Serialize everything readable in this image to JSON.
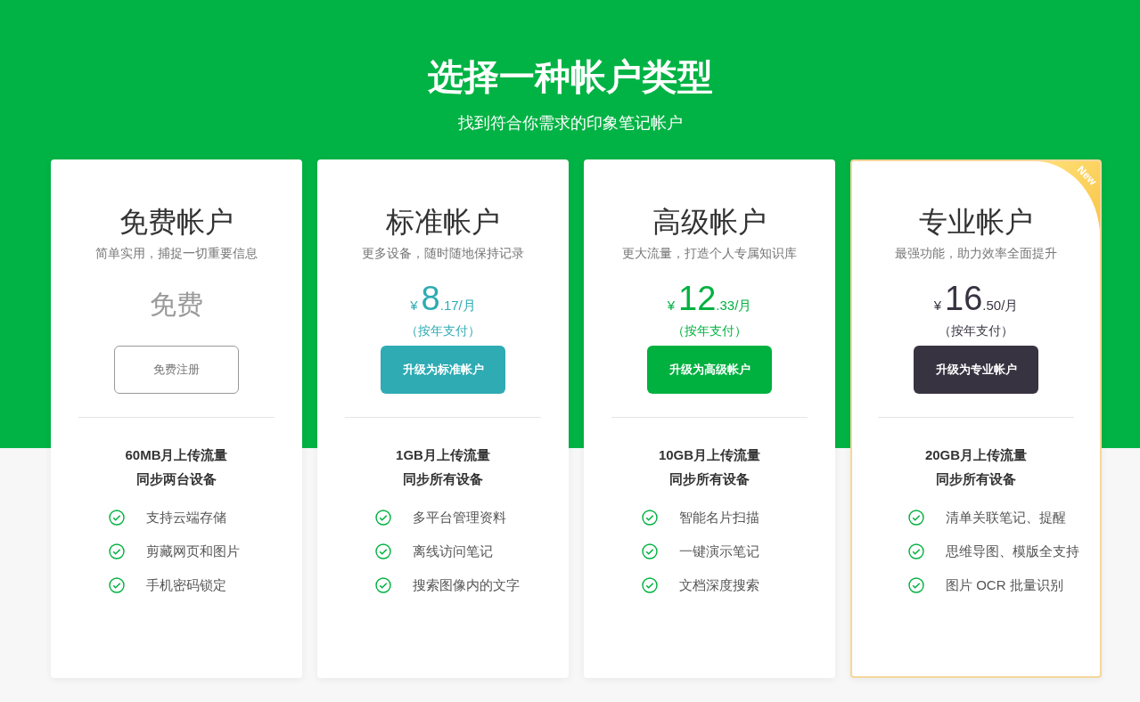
{
  "header": {
    "title": "选择一种帐户类型",
    "subtitle": "找到符合你需求的印象笔记帐户"
  },
  "plans": [
    {
      "kind": "free",
      "name": "免费帐户",
      "tagline": "简单实用，捕捉一切重要信息",
      "price_text": "免费",
      "button": "免费注册",
      "highlighted": false,
      "quota": "60MB月上传流量",
      "devices": "同步两台设备",
      "features": [
        "支持云端存储",
        "剪藏网页和图片",
        "手机密码锁定"
      ]
    },
    {
      "kind": "paid",
      "name": "标准帐户",
      "tagline": "更多设备，随时随地保持记录",
      "color": "#2eabb3",
      "currency": "¥",
      "price_major": "8",
      "price_minor": ".17/月",
      "billing": "（按年支付）",
      "button": "升级为标准帐户",
      "highlighted": false,
      "quota": "1GB月上传流量",
      "devices": "同步所有设备",
      "features": [
        "多平台管理资料",
        "离线访问笔记",
        "搜索图像内的文字"
      ]
    },
    {
      "kind": "paid",
      "name": "高级帐户",
      "tagline": "更大流量，打造个人专属知识库",
      "color": "#00b140",
      "currency": "¥",
      "price_major": "12",
      "price_minor": ".33/月",
      "billing": "（按年支付）",
      "button": "升级为高级帐户",
      "highlighted": false,
      "quota": "10GB月上传流量",
      "devices": "同步所有设备",
      "features": [
        "智能名片扫描",
        "一键演示笔记",
        "文档深度搜索"
      ]
    },
    {
      "kind": "paid",
      "name": "专业帐户",
      "tagline": "最强功能，助力效率全面提升",
      "color": "#383341",
      "currency": "¥",
      "price_major": "16",
      "price_minor": ".50/月",
      "billing": "（按年支付）",
      "button": "升级为专业帐户",
      "highlighted": true,
      "badge": "New",
      "quota": "20GB月上传流量",
      "devices": "同步所有设备",
      "features": [
        "清单关联笔记、提醒",
        "思维导图、模版全支持",
        "图片 OCR 批量识别"
      ]
    }
  ]
}
